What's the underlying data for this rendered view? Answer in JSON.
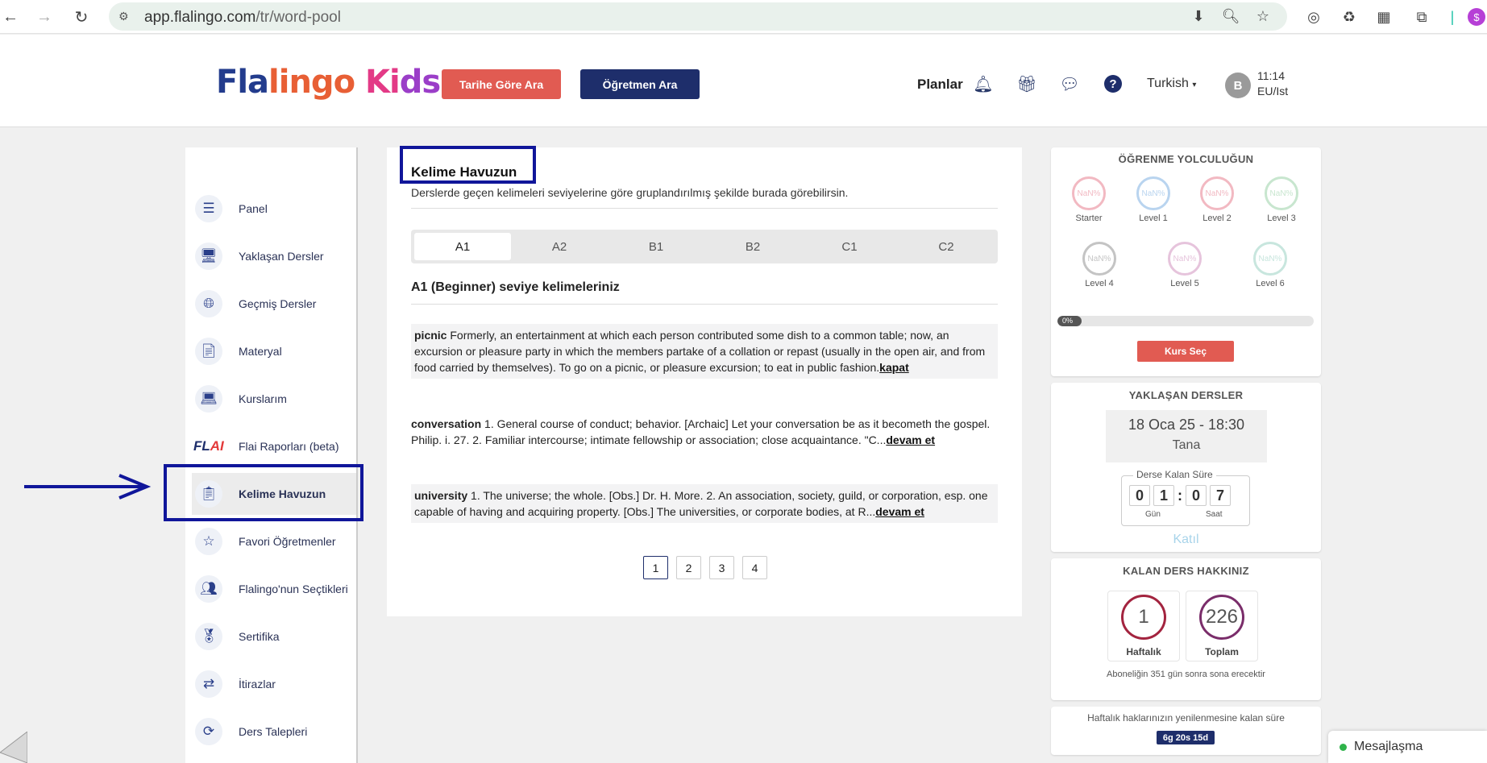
{
  "browser": {
    "url_host": "app.flalingo.com",
    "url_path": "/tr/word-pool"
  },
  "header": {
    "logo_parts": [
      "Fla",
      "lingo",
      " Ki",
      "ds"
    ],
    "search_by_date": "Tarihe Göre Ara",
    "search_teacher": "Öğretmen Ara",
    "plans": "Planlar",
    "language": "Turkish",
    "avatar_initial": "B",
    "time": "11:14",
    "timezone": "EU/Ist"
  },
  "sidebar": {
    "items": [
      {
        "label": "Panel",
        "icon": "panel-icon"
      },
      {
        "label": "Yaklaşan Dersler",
        "icon": "upcoming-lessons-icon"
      },
      {
        "label": "Geçmiş Dersler",
        "icon": "past-lessons-icon"
      },
      {
        "label": "Materyal",
        "icon": "material-icon"
      },
      {
        "label": "Kurslarım",
        "icon": "courses-icon"
      },
      {
        "label": "Flai Raporları (beta)",
        "icon": "flai-logo"
      },
      {
        "label": "Kelime Havuzun",
        "icon": "word-pool-icon"
      },
      {
        "label": "Favori Öğretmenler",
        "icon": "favorite-icon"
      },
      {
        "label": "Flalingo'nun Seçtikleri",
        "icon": "picks-icon"
      },
      {
        "label": "Sertifika",
        "icon": "certificate-icon"
      },
      {
        "label": "İtirazlar",
        "icon": "objections-icon"
      },
      {
        "label": "Ders Talepleri",
        "icon": "lesson-requests-icon"
      }
    ],
    "flai_logo": {
      "main": "FL",
      "accent": "AI"
    }
  },
  "main": {
    "title": "Kelime Havuzun",
    "subtitle": "Derslerde geçen kelimeleri seviyelerine göre gruplandırılmış şekilde burada görebilirsin.",
    "tabs": [
      "A1",
      "A2",
      "B1",
      "B2",
      "C1",
      "C2"
    ],
    "active_tab": "A1",
    "level_heading": "A1 (Beginner) seviye kelimeleriniz",
    "words": [
      {
        "word": "picnic",
        "definition": " Formerly, an entertainment at which each person contributed some dish to a common table; now, an excursion or pleasure party in which the members partake of a collation or repast (usually in the open air, and from food carried by themselves). To go on a picnic, or pleasure excursion; to eat in public fashion.",
        "link": "kapat"
      },
      {
        "word": "conversation",
        "definition": " 1. General course of conduct; behavior. [Archaic] Let your conversation be as it becometh the gospel. Philip. i. 27. 2. Familiar intercourse; intimate fellowship or association; close acquaintance. \"C...",
        "link": "devam et"
      },
      {
        "word": "university",
        "definition": " 1. The universe; the whole. [Obs.] Dr. H. More. 2. An association, society, guild, or corporation, esp. one capable of having and acquiring property. [Obs.] The universities, or corporate bodies, at R...",
        "link": "devam et"
      }
    ],
    "pages": [
      "1",
      "2",
      "3",
      "4"
    ],
    "current_page": "1"
  },
  "journey": {
    "title": "ÖĞRENME YOLCULUĞUN",
    "levels": [
      {
        "label": "Starter",
        "value": "NaN%",
        "color": "#f2b9c2"
      },
      {
        "label": "Level 1",
        "value": "NaN%",
        "color": "#b9d4ef"
      },
      {
        "label": "Level 2",
        "value": "NaN%",
        "color": "#f2b9c2"
      },
      {
        "label": "Level 3",
        "value": "NaN%",
        "color": "#c8e6cf"
      },
      {
        "label": "Level 4",
        "value": "NaN%",
        "color": "#c4c4c4"
      },
      {
        "label": "Level 5",
        "value": "NaN%",
        "color": "#e6c4dc"
      },
      {
        "label": "Level 6",
        "value": "NaN%",
        "color": "#c8e6de"
      }
    ],
    "progress_label": "0%",
    "progress": 0,
    "choose_course": "Kurs Seç"
  },
  "upcoming": {
    "title": "YAKLAŞAN DERSLER",
    "date": "18 Oca 25 - 18:30",
    "teacher": "Tana",
    "countdown_title": "Derse Kalan Süre",
    "digits": [
      "0",
      "1",
      "0",
      "7"
    ],
    "day_label": "Gün",
    "hour_label": "Saat",
    "join": "Katıl"
  },
  "rights": {
    "title": "KALAN DERS HAKKINIZ",
    "weekly_value": "1",
    "weekly_label": "Haftalık",
    "total_value": "226",
    "total_label": "Toplam",
    "subscription_note": "Aboneliğin 351 gün sonra sona erecektir"
  },
  "weekly_reset": {
    "text": "Haftalık haklarınızın yenilenmesine kalan süre",
    "badge": "6g 20s 15d"
  },
  "chat": {
    "label": "Mesajlaşma"
  }
}
